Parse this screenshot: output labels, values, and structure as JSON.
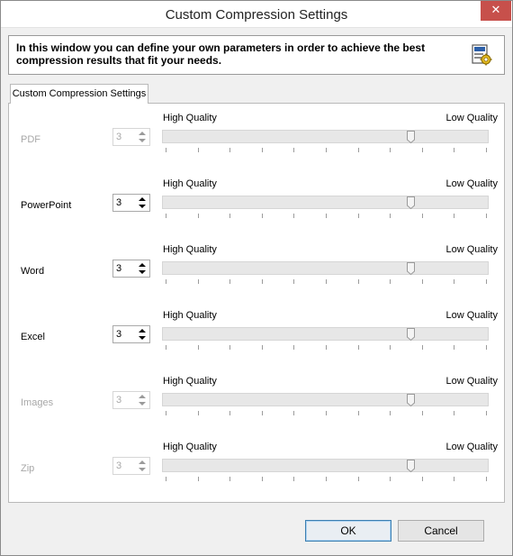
{
  "window": {
    "title": "Custom Compression Settings",
    "close_glyph": "✕"
  },
  "header": {
    "text": "In this window you can define your own parameters in order to achieve the best compression results that fit your needs.",
    "icon": "settings-gear-icon"
  },
  "tab": {
    "label": "Custom Compression Settings"
  },
  "quality_labels": {
    "high": "High Quality",
    "low": "Low Quality"
  },
  "rows": [
    {
      "label": "PDF",
      "value": "3",
      "level": 0.77,
      "enabled": false
    },
    {
      "label": "PowerPoint",
      "value": "3",
      "level": 0.77,
      "enabled": true
    },
    {
      "label": "Word",
      "value": "3",
      "level": 0.77,
      "enabled": true
    },
    {
      "label": "Excel",
      "value": "3",
      "level": 0.77,
      "enabled": true
    },
    {
      "label": "Images",
      "value": "3",
      "level": 0.77,
      "enabled": false
    },
    {
      "label": "Zip",
      "value": "3",
      "level": 0.77,
      "enabled": false
    }
  ],
  "buttons": {
    "ok": "OK",
    "cancel": "Cancel"
  },
  "colors": {
    "close": "#c7504b",
    "accent": "#3c7fb1"
  }
}
